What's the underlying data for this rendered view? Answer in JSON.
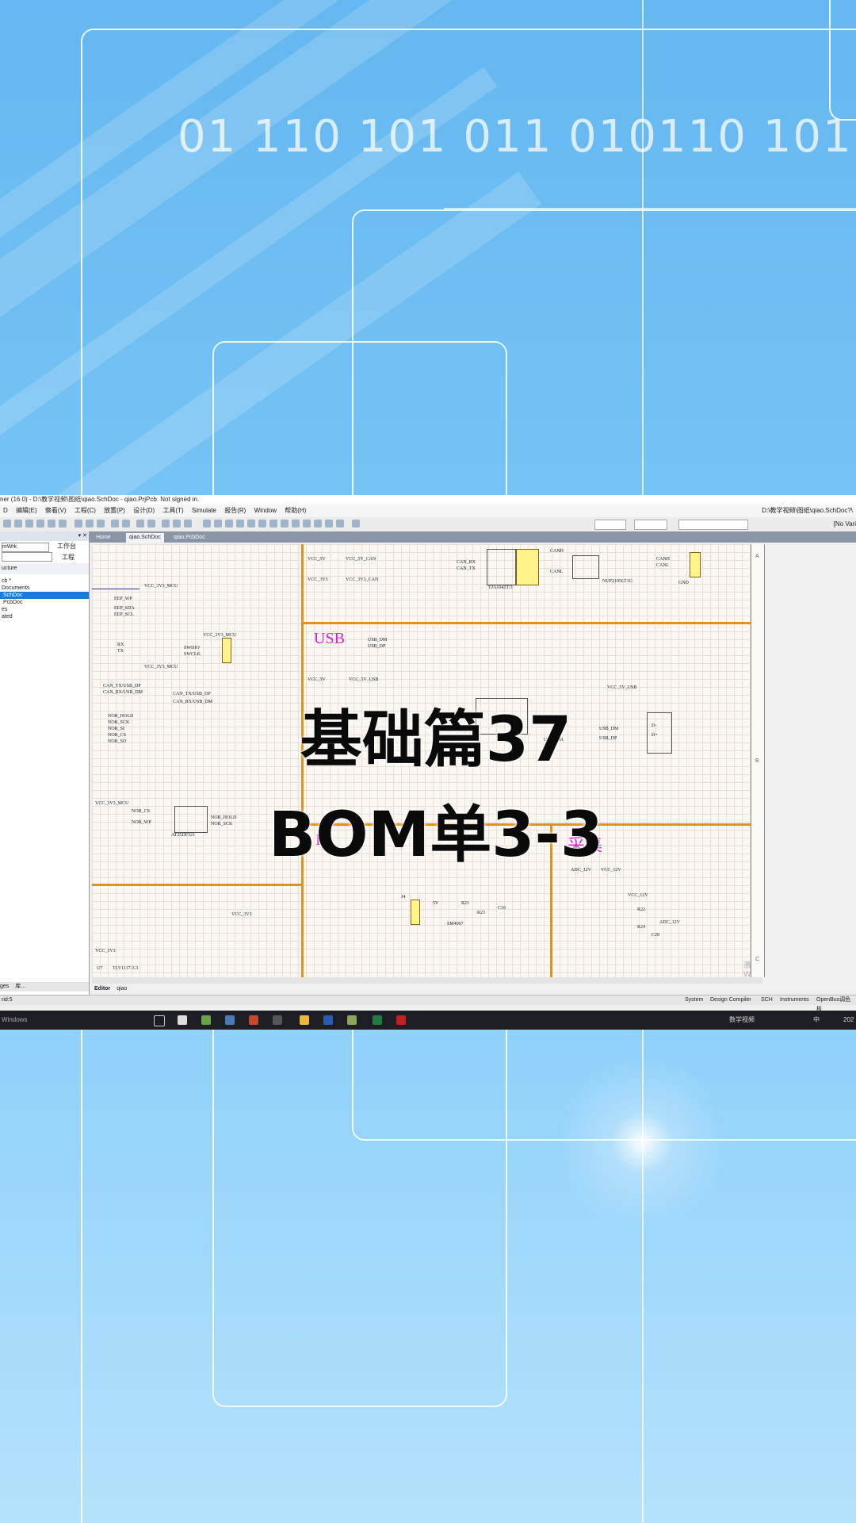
{
  "background": {
    "binary_text": "01  110  101  011  010110  101  0101"
  },
  "window": {
    "title": "ner (16.0) - D:\\教学视频\\图纸\\qiao.SchDoc - qiao.PrjPcb. Not signed in.",
    "menu": [
      "编辑(E)",
      "察看(V)",
      "工程(C)",
      "放置(P)",
      "设计(D)",
      "工具(T)",
      "Simulate",
      "报告(R)",
      "Window",
      "帮助(H)"
    ],
    "menu_first": "D",
    "path_right": "D:\\教学视频\\图纸\\qiao.SchDoc?\\",
    "variant": "[No Vari"
  },
  "panel": {
    "combo_value": "mWrk",
    "workspace_button": "工作台",
    "project_button": "工程",
    "structure_label": "ucture",
    "tree": [
      {
        "label": "cb *",
        "selected": false
      },
      {
        "label": "Documents",
        "selected": false
      },
      {
        "label": ".SchDoc",
        "selected": true
      },
      {
        "label": ".PcbDoc",
        "selected": false
      },
      {
        "label": "es",
        "selected": false
      },
      {
        "label": "ated",
        "selected": false
      }
    ],
    "bottom_tabs": [
      "ges",
      "库..."
    ]
  },
  "doc_tabs": [
    {
      "label": "Home",
      "active": false
    },
    {
      "label": "qiao.SchDoc",
      "active": true
    },
    {
      "label": "qiao.PcbDoc",
      "active": false
    }
  ],
  "schematic": {
    "section_labels": {
      "usb": "USB",
      "in": "IN",
      "collect": "采集"
    },
    "border_marks": [
      "A",
      "B",
      "C"
    ],
    "nets_top": [
      "VCC_5V",
      "VCC_5V_CAN",
      "VCC_3V3",
      "VCC_3V3_CAN",
      "CANH",
      "CANL",
      "CAN_RX",
      "CAN_TX",
      "TJA1042T/3",
      "NUP2105LT1G",
      "GND"
    ],
    "nets_left": [
      "VCC_3V3_MCU",
      "EEP_WP",
      "EEP_SDA",
      "EEP_SCL",
      "RX",
      "TX",
      "SWDIO",
      "SWCLK",
      "CAN_TX/USB_DP",
      "CAN_RX/USB_DM",
      "NOR_HOLD",
      "NOR_SCK",
      "NOR_SI",
      "NOR_CS",
      "NOR_SO",
      "NOR_WP",
      "AT25DF321"
    ],
    "nets_usb": [
      "USB_DM",
      "USB_DP",
      "VCC_5V_USB",
      "D-",
      "D+",
      "GND",
      "VCC_5V_MCU"
    ],
    "nets_bottom": [
      "VCC_3V3",
      "TLV1117-3.3",
      "U7",
      "VCC_12V",
      "ADC_12V",
      "R21",
      "R22",
      "R23",
      "R24",
      "C16",
      "C20",
      "5V",
      "SM4007",
      "J4"
    ]
  },
  "editor_tabs": [
    "Editor",
    "qiao"
  ],
  "status": {
    "left": "rid:5",
    "items": [
      "System",
      "Design Compiler",
      "SCH",
      "Instruments",
      "OpenBus调色板"
    ]
  },
  "taskbar": {
    "search": "Windows",
    "tray": "数学视频",
    "ime": "中",
    "clock": "202"
  },
  "watermark": "激活 Windows",
  "overlay": {
    "line1": "基础篇37",
    "line2": "BOM单3-3"
  },
  "colors": {
    "sheet_bar": "#e2921a",
    "section_label": "#d021d0",
    "selection": "#1e78d6"
  }
}
